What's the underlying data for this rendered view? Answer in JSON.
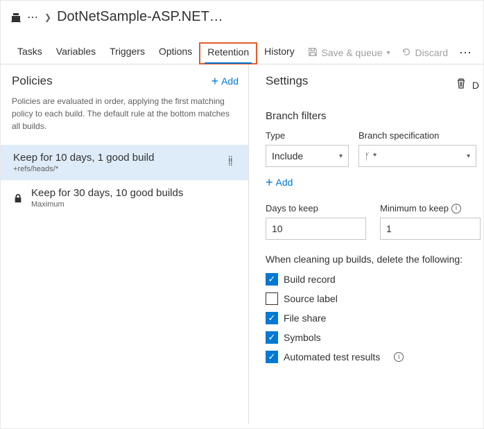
{
  "header": {
    "title": "DotNetSample-ASP.NET…"
  },
  "tabs": {
    "tasks": "Tasks",
    "variables": "Variables",
    "triggers": "Triggers",
    "options": "Options",
    "retention": "Retention",
    "history": "History"
  },
  "toolbar": {
    "save_queue": "Save & queue",
    "discard": "Discard",
    "delete_prefix": "D"
  },
  "policies": {
    "heading": "Policies",
    "add_label": "Add",
    "description": "Policies are evaluated in order, applying the first matching policy to each build. The default rule at the bottom matches all builds.",
    "items": [
      {
        "name": "Keep for 10 days, 1 good build",
        "sub": "+refs/heads/*"
      },
      {
        "name": "Keep for 30 days, 10 good builds",
        "sub": "Maximum"
      }
    ]
  },
  "settings": {
    "heading": "Settings",
    "branch_filters_heading": "Branch filters",
    "type_label": "Type",
    "type_value": "Include",
    "branch_spec_label": "Branch specification",
    "branch_spec_value": "*",
    "add_label": "Add",
    "days_label": "Days to keep",
    "days_value": "10",
    "min_label": "Minimum to keep",
    "min_value": "1",
    "cleanup_label": "When cleaning up builds, delete the following:",
    "checks": {
      "build_record": "Build record",
      "source_label": "Source label",
      "file_share": "File share",
      "symbols": "Symbols",
      "automated": "Automated test results"
    }
  }
}
